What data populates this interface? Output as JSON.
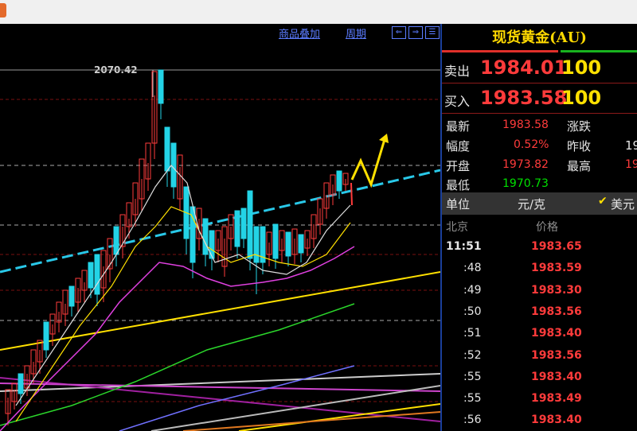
{
  "chart": {
    "toolbar": {
      "overlay": "商品叠加",
      "period": "周期"
    },
    "buttons": [
      "⇐",
      "⇒",
      "☰"
    ],
    "high_label": "2070.42"
  },
  "quote": {
    "title": "现货黄金(AU)",
    "sell": {
      "label": "卖出",
      "price": "1984.01",
      "volume": "100"
    },
    "buy": {
      "label": "买入",
      "price": "1983.58",
      "volume": "100"
    },
    "stats": [
      {
        "label": "最新",
        "value": "1983.58",
        "label2": "涨跌",
        "value2": ""
      },
      {
        "label": "幅度",
        "value": "0.52%",
        "label2": "昨收",
        "value2": "19"
      },
      {
        "label": "开盘",
        "value": "1973.82",
        "label2": "最高",
        "value2": "19"
      },
      {
        "label": "最低",
        "value": "1970.73",
        "label2": "",
        "value2": ""
      }
    ],
    "unit": {
      "label": "单位",
      "value": "元/克",
      "option": "美元"
    },
    "ticks_header": {
      "time": "北京",
      "price": "价格"
    },
    "ticks": [
      {
        "time": "11:51",
        "price": "1983.65"
      },
      {
        "time": ":48",
        "price": "1983.59"
      },
      {
        "time": ":49",
        "price": "1983.30"
      },
      {
        "time": ":50",
        "price": "1983.56"
      },
      {
        "time": ":51",
        "price": "1983.40"
      },
      {
        "time": ":52",
        "price": "1983.56"
      },
      {
        "time": ":55",
        "price": "1983.40"
      },
      {
        "time": ":55",
        "price": "1983.49"
      },
      {
        "time": ":56",
        "price": "1983.40"
      }
    ]
  },
  "colors": {
    "up": "#ff3b3b",
    "down": "#23d3e6",
    "ma5": "#dddddd",
    "ma10": "#ffe000",
    "ma20": "#e040e0",
    "ma60": "#2bd62b",
    "ma120": "#7070ff"
  }
}
